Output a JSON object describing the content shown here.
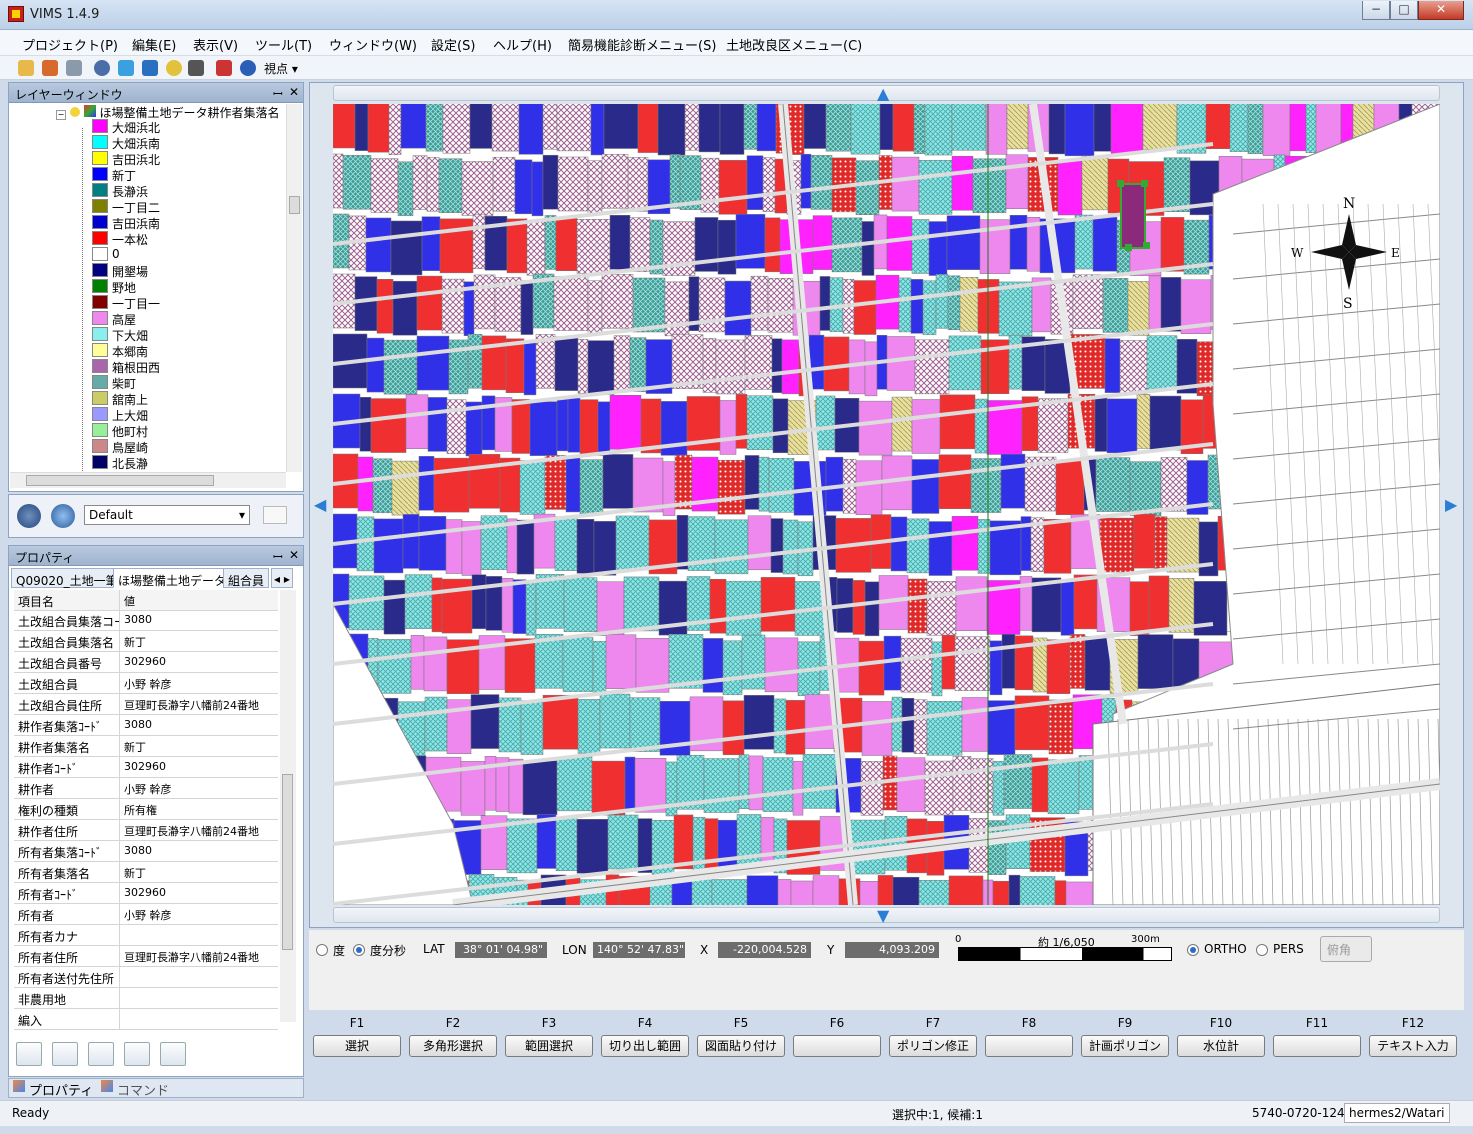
{
  "window": {
    "title": "VIMS 1.4.9",
    "min": "−",
    "max": "□",
    "close": "✕"
  },
  "menu": [
    "プロジェクト(P)",
    "編集(E)",
    "表示(V)",
    "ツール(T)",
    "ウィンドウ(W)",
    "設定(S)",
    "ヘルプ(H)",
    "簡易機能診断メニュー(S)",
    "土地改良区メニュー(C)"
  ],
  "toolbar": {
    "viewpoint": "視点 ▾"
  },
  "layer_window": {
    "title": "レイヤーウィンドウ",
    "pin": "ꟷ",
    "close": "✕",
    "root": "ほ場整備土地データ耕作者集落名",
    "layers": [
      {
        "name": "大畑浜北",
        "color": "#ff00ff"
      },
      {
        "name": "大畑浜南",
        "color": "#00ffff"
      },
      {
        "name": "吉田浜北",
        "color": "#ffff00"
      },
      {
        "name": "新丁",
        "color": "#0000ff"
      },
      {
        "name": "長瀞浜",
        "color": "#008080"
      },
      {
        "name": "一丁目二",
        "color": "#808000"
      },
      {
        "name": "吉田浜南",
        "color": "#0000cc"
      },
      {
        "name": "一本松",
        "color": "#ff0000"
      },
      {
        "name": "0",
        "color": "#ffffff"
      },
      {
        "name": "開墾場",
        "color": "#000080"
      },
      {
        "name": "野地",
        "color": "#008000"
      },
      {
        "name": "一丁目一",
        "color": "#800000"
      },
      {
        "name": "高屋",
        "color": "#ee88ee"
      },
      {
        "name": "下大畑",
        "color": "#88eeee"
      },
      {
        "name": "本郷南",
        "color": "#ffff99"
      },
      {
        "name": "箱根田西",
        "color": "#aa66aa"
      },
      {
        "name": "柴町",
        "color": "#66aaaa"
      },
      {
        "name": "舘南上",
        "color": "#cccc66"
      },
      {
        "name": "上大畑",
        "color": "#9999ff"
      },
      {
        "name": "他町村",
        "color": "#99ee99"
      },
      {
        "name": "鳥屋崎",
        "color": "#cc8888"
      },
      {
        "name": "北長瀞",
        "color": "#000066"
      }
    ],
    "style": "Default"
  },
  "properties": {
    "title": "プロパティ",
    "pin": "ꟷ",
    "close": "✕",
    "tabs": [
      "Q09020_土地一筆",
      "ほ場整備土地データ",
      "組合員"
    ],
    "tab_arrows": "◂ ▸",
    "header": {
      "key": "項目名",
      "value": "値"
    },
    "rows": [
      {
        "key": "土改組合員集落コード",
        "value": "3080"
      },
      {
        "key": "土改組合員集落名",
        "value": "新丁"
      },
      {
        "key": "土改組合員番号",
        "value": "302960"
      },
      {
        "key": "土改組合員",
        "value": "小野 幹彦"
      },
      {
        "key": "土改組合員住所",
        "value": "亘理町長瀞字八幡前24番地"
      },
      {
        "key": "耕作者集落ｺｰﾄﾞ",
        "value": "3080"
      },
      {
        "key": "耕作者集落名",
        "value": "新丁"
      },
      {
        "key": "耕作者ｺｰﾄﾞ",
        "value": "302960"
      },
      {
        "key": "耕作者",
        "value": "小野 幹彦"
      },
      {
        "key": "権利の種類",
        "value": "所有権"
      },
      {
        "key": "耕作者住所",
        "value": "亘理町長瀞字八幡前24番地"
      },
      {
        "key": "所有者集落ｺｰﾄﾞ",
        "value": "3080"
      },
      {
        "key": "所有者集落名",
        "value": "新丁"
      },
      {
        "key": "所有者ｺｰﾄﾞ",
        "value": "302960"
      },
      {
        "key": "所有者",
        "value": "小野 幹彦"
      },
      {
        "key": "所有者カナ",
        "value": ""
      },
      {
        "key": "所有者住所",
        "value": "亘理町長瀞字八幡前24番地"
      },
      {
        "key": "所有者送付先住所",
        "value": ""
      },
      {
        "key": "非農用地",
        "value": ""
      },
      {
        "key": "編入",
        "value": ""
      }
    ],
    "bottom_tabs": [
      "プロパティ",
      "コマンド"
    ]
  },
  "map": {
    "compass": {
      "n": "N",
      "s": "S",
      "e": "E",
      "w": "W"
    }
  },
  "coords": {
    "deg": "度",
    "dms": "度分秒",
    "lat_label": "LAT",
    "lat": "38° 01' 04.98\"",
    "lon_label": "LON",
    "lon": "140° 52' 47.83\"",
    "x_label": "X",
    "x": "-220,004.528",
    "y_label": "Y",
    "y": "4,093.209",
    "scale_zero": "0",
    "scale_ratio": "約 1/6,050",
    "scale_end": "300m",
    "ortho": "ORTHO",
    "pers": "PERS",
    "tilt": "俯角"
  },
  "fkeys": [
    {
      "key": "F1",
      "label": "選択"
    },
    {
      "key": "F2",
      "label": "多角形選択"
    },
    {
      "key": "F3",
      "label": "範囲選択"
    },
    {
      "key": "F4",
      "label": "切り出し範囲"
    },
    {
      "key": "F5",
      "label": "図面貼り付け"
    },
    {
      "key": "F6",
      "label": ""
    },
    {
      "key": "F7",
      "label": "ポリゴン修正"
    },
    {
      "key": "F8",
      "label": ""
    },
    {
      "key": "F9",
      "label": "計画ポリゴン"
    },
    {
      "key": "F10",
      "label": "水位計"
    },
    {
      "key": "F11",
      "label": ""
    },
    {
      "key": "F12",
      "label": "テキスト入力"
    }
  ],
  "status": {
    "ready": "Ready",
    "selection": "選択中:1, 候補:1",
    "code": "5740-0720-124",
    "user": "hermes2/Watari"
  }
}
